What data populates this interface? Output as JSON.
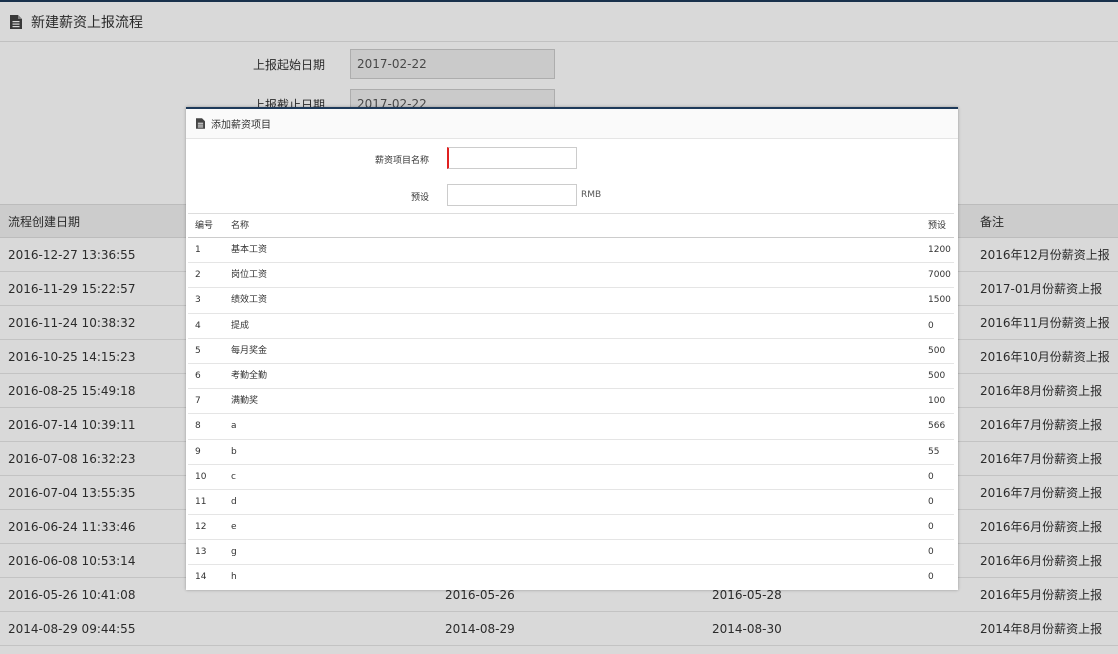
{
  "page": {
    "title": "新建薪资上报流程",
    "start_date_label": "上报起始日期",
    "start_date_value": "2017-02-22",
    "end_date_label": "上报截止日期",
    "end_date_value": "2017-02-22"
  },
  "main_table": {
    "headers": {
      "created": "流程创建日期",
      "note": "备注"
    },
    "rows": [
      {
        "created": "2016-12-27 13:36:55",
        "start": "",
        "end": "",
        "note": "2016年12月份薪资上报"
      },
      {
        "created": "2016-11-29 15:22:57",
        "start": "",
        "end": "",
        "note": "2017-01月份薪资上报"
      },
      {
        "created": "2016-11-24 10:38:32",
        "start": "",
        "end": "",
        "note": "2016年11月份薪资上报"
      },
      {
        "created": "2016-10-25 14:15:23",
        "start": "",
        "end": "",
        "note": "2016年10月份薪资上报"
      },
      {
        "created": "2016-08-25 15:49:18",
        "start": "",
        "end": "",
        "note": "2016年8月份薪资上报"
      },
      {
        "created": "2016-07-14 10:39:11",
        "start": "",
        "end": "",
        "note": "2016年7月份薪资上报"
      },
      {
        "created": "2016-07-08 16:32:23",
        "start": "",
        "end": "",
        "note": "2016年7月份薪资上报"
      },
      {
        "created": "2016-07-04 13:55:35",
        "start": "",
        "end": "",
        "note": "2016年7月份薪资上报"
      },
      {
        "created": "2016-06-24 11:33:46",
        "start": "",
        "end": "",
        "note": "2016年6月份薪资上报"
      },
      {
        "created": "2016-06-08 10:53:14",
        "start": "",
        "end": "",
        "note": "2016年6月份薪资上报"
      },
      {
        "created": "2016-05-26 10:41:08",
        "start": "2016-05-26",
        "end": "2016-05-28",
        "note": "2016年5月份薪资上报"
      },
      {
        "created": "2014-08-29 09:44:55",
        "start": "2014-08-29",
        "end": "2014-08-30",
        "note": "2014年8月份薪资上报"
      }
    ]
  },
  "modal": {
    "title": "添加薪资项目",
    "name_label": "薪资项目名称",
    "name_value": "",
    "preset_label": "预设",
    "preset_value": "",
    "unit": "RMB",
    "headers": {
      "no": "编号",
      "name": "名称",
      "preset": "预设"
    },
    "rows": [
      {
        "no": "1",
        "name": "基本工资",
        "preset": "1200"
      },
      {
        "no": "2",
        "name": "岗位工资",
        "preset": "7000"
      },
      {
        "no": "3",
        "name": "绩效工资",
        "preset": "1500"
      },
      {
        "no": "4",
        "name": "提成",
        "preset": "0"
      },
      {
        "no": "5",
        "name": "每月奖金",
        "preset": "500"
      },
      {
        "no": "6",
        "name": "考勤全勤",
        "preset": "500"
      },
      {
        "no": "7",
        "name": "满勤奖",
        "preset": "100"
      },
      {
        "no": "8",
        "name": "a",
        "preset": "566"
      },
      {
        "no": "9",
        "name": "b",
        "preset": "55"
      },
      {
        "no": "10",
        "name": "c",
        "preset": "0"
      },
      {
        "no": "11",
        "name": "d",
        "preset": "0"
      },
      {
        "no": "12",
        "name": "e",
        "preset": "0"
      },
      {
        "no": "13",
        "name": "g",
        "preset": "0"
      },
      {
        "no": "14",
        "name": "h",
        "preset": "0"
      }
    ]
  }
}
